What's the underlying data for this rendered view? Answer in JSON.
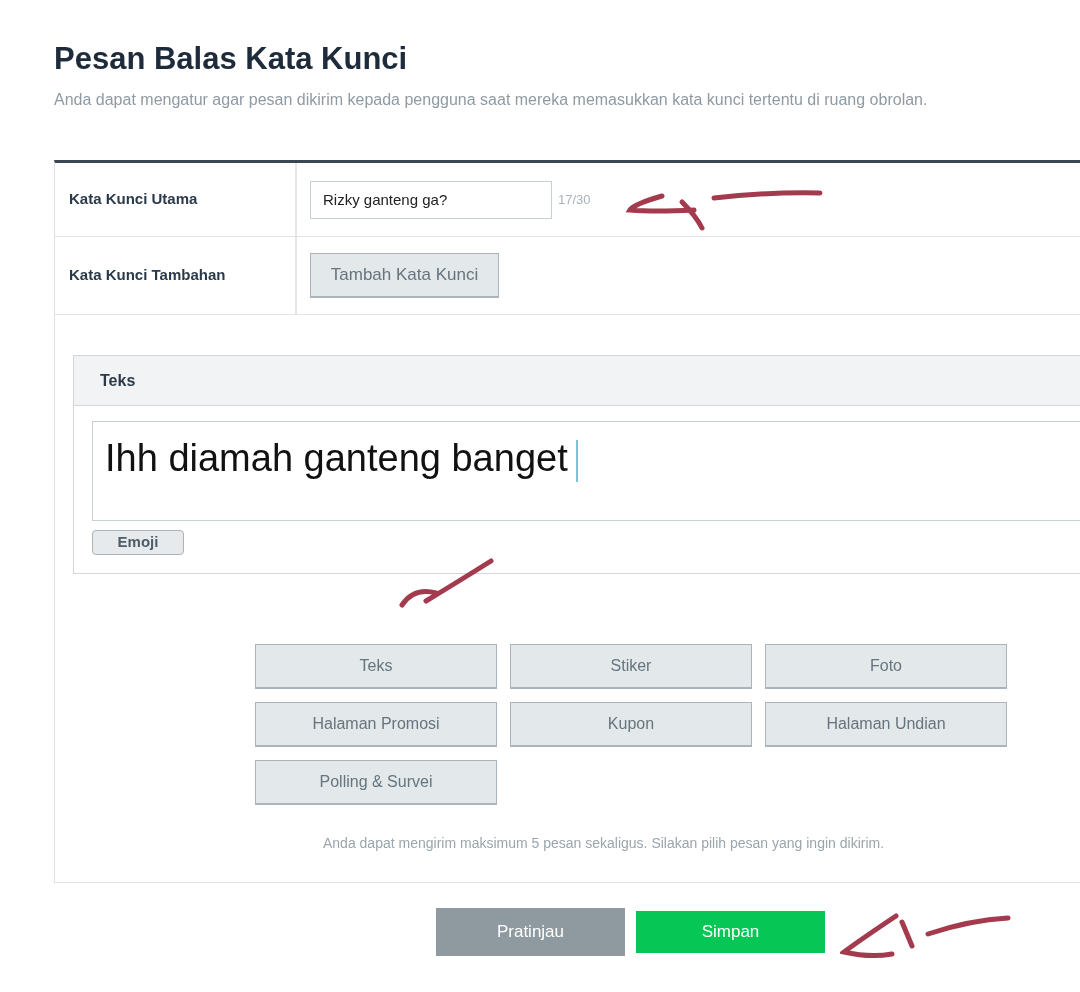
{
  "title": "Pesan Balas Kata Kunci",
  "subtitle": "Anda dapat mengatur agar pesan dikirim kepada pengguna saat mereka memasukkan kata kunci tertentu di ruang obrolan.",
  "main_keyword": {
    "label": "Kata Kunci Utama",
    "value": "Rizky ganteng ga?",
    "counter": "17/30"
  },
  "extra_keyword": {
    "label": "Kata Kunci Tambahan",
    "button": "Tambah Kata Kunci"
  },
  "message": {
    "header": "Teks",
    "value": "Ihh diamah ganteng banget",
    "emoji_button": "Emoji"
  },
  "message_types": [
    "Teks",
    "Stiker",
    "Foto",
    "Halaman Promosi",
    "Kupon",
    "Halaman Undian",
    "Polling & Survei"
  ],
  "note": "Anda dapat mengirim maksimum 5 pesan sekaligus. Silakan pilih pesan yang ingin dikirim.",
  "buttons": [
    {
      "label": "Pratinjau",
      "kind": "secondary"
    },
    {
      "label": "Simpan",
      "kind": "primary"
    }
  ]
}
